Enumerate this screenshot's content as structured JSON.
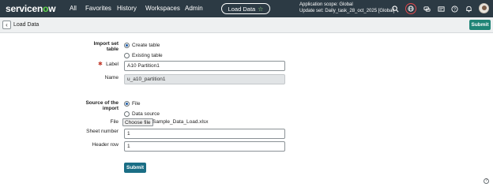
{
  "nav": {
    "logo": "servicenow",
    "menus": [
      "All",
      "Favorites",
      "History",
      "Workspaces",
      "Admin"
    ],
    "context_pill": "Load Data",
    "scope_line1": "Application scope: Global",
    "scope_line2": "Update set: Daily_task_28_oct_2025 [Global]"
  },
  "header": {
    "title": "Load Data",
    "submit_label": "Submit"
  },
  "form": {
    "import_set_table_label": "Import set table",
    "create_table_label": "Create table",
    "existing_table_label": "Existing table",
    "label_label": "Label",
    "label_value": "A10 Partition1",
    "name_label": "Name",
    "name_value": "u_a10_partition1",
    "source_label": "Source of the import",
    "source_file_label": "File",
    "source_datasource_label": "Data source",
    "file_label": "File",
    "choose_file_label": "Choose file",
    "file_name": "Sample_Data_Load.xlsx",
    "sheet_number_label": "Sheet number",
    "sheet_number_value": "1",
    "header_row_label": "Header row",
    "header_row_value": "1",
    "submit_label": "Submit"
  },
  "colors": {
    "nav_bg": "#2c3a44",
    "accent_green": "#62d84e",
    "submit_bg": "#1f8476",
    "alert_ring": "#e5484d"
  },
  "icons": {
    "search": "search-icon",
    "globe": "globe-icon",
    "chat": "chat-icon",
    "news": "news-icon",
    "help": "help-icon",
    "bell": "bell-icon"
  }
}
